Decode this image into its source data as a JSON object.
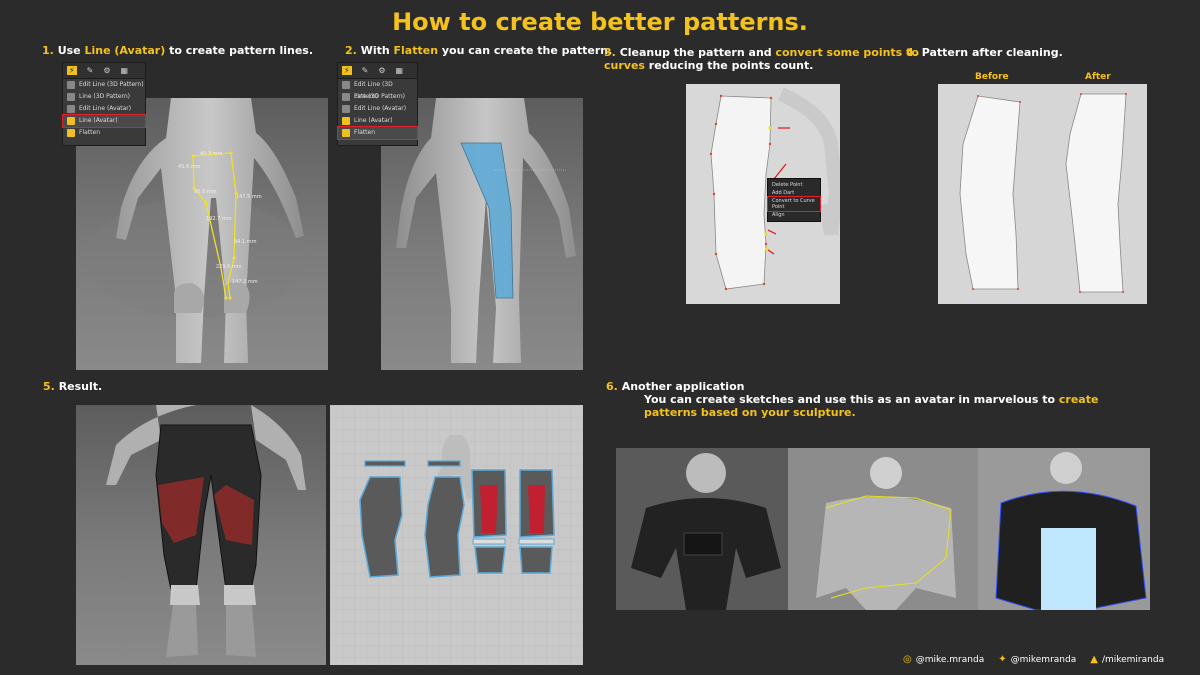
{
  "title": "How to create better patterns.",
  "steps": {
    "s1": {
      "num": "1.",
      "pre": "Use ",
      "hl": "Line (Avatar)",
      "post": " to create pattern lines."
    },
    "s2": {
      "num": "2.",
      "pre": "With ",
      "hl": "Flatten",
      "post": " you can create the pattern."
    },
    "s3": {
      "num": "3.",
      "pre": "Cleanup the pattern and ",
      "hl": "convert some points to",
      "line2_hl": "curves",
      "line2_post": " reducing the points count."
    },
    "s4": {
      "num": "4.",
      "text": "Pattern after cleaning."
    },
    "s5": {
      "num": "5.",
      "text": "Result."
    },
    "s6": {
      "num": "6.",
      "text": "Another application",
      "line2": "You can create sketches and use this as an avatar in marvelous to ",
      "line2_hl": "create",
      "line3_hl": "patterns based on your sculpture."
    }
  },
  "menu1": {
    "items": [
      "Edit Line (3D Pattern)",
      "Line (3D Pattern)",
      "Edit Line (Avatar)",
      "Line (Avatar)",
      "Flatten"
    ],
    "selected_index": 3
  },
  "menu2": {
    "items": [
      "Edit Line (3D Pattern)",
      "Line (3D Pattern)",
      "Edit Line (Avatar)",
      "Line (Avatar)",
      "Flatten"
    ],
    "selected_index": 4
  },
  "context_menu": {
    "items": [
      "Delete Point",
      "Add Dart",
      "Convert to Curve Point",
      "Align"
    ]
  },
  "panel4": {
    "before": "Before",
    "after": "After"
  },
  "measurements1": [
    "40.3 mm",
    "45.6 mm",
    "86.6 mm",
    "147.5 mm",
    "192.7 mm",
    "94.1 mm",
    "229.5 mm",
    "147.2 mm"
  ],
  "footer": {
    "instagram": "@mike.mranda",
    "twitter": "@mikemranda",
    "artstation": "/mikemiranda"
  },
  "colors": {
    "accent": "#f5c21b",
    "background": "#2b2b2b",
    "highlight_red": "#e0202a",
    "pattern_blue": "#5aa9d8"
  }
}
